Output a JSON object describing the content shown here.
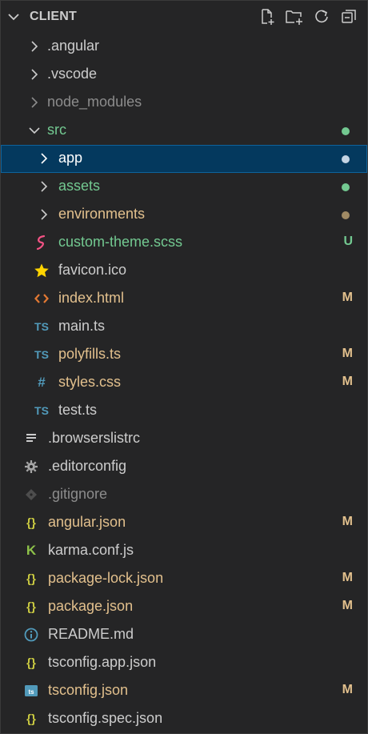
{
  "header": {
    "title": "CLIENT",
    "actions": [
      {
        "name": "new-file-icon"
      },
      {
        "name": "new-folder-icon"
      },
      {
        "name": "refresh-icon"
      },
      {
        "name": "collapse-all-icon"
      }
    ]
  },
  "tree": {
    "angular_folder": ".angular",
    "vscode_folder": ".vscode",
    "node_modules_folder": "node_modules",
    "src_folder": "src",
    "app_folder": "app",
    "assets_folder": "assets",
    "environments_folder": "environments",
    "custom_theme_file": "custom-theme.scss",
    "custom_theme_badge": "U",
    "favicon_file": "favicon.ico",
    "index_html_file": "index.html",
    "index_html_badge": "M",
    "main_ts_file": "main.ts",
    "polyfills_file": "polyfills.ts",
    "polyfills_badge": "M",
    "styles_file": "styles.css",
    "styles_badge": "M",
    "test_ts_file": "test.ts",
    "browserslistrc_file": ".browserslistrc",
    "editorconfig_file": ".editorconfig",
    "gitignore_file": ".gitignore",
    "angular_json_file": "angular.json",
    "angular_json_badge": "M",
    "karma_file": "karma.conf.js",
    "package_lock_file": "package-lock.json",
    "package_lock_badge": "M",
    "package_json_file": "package.json",
    "package_json_badge": "M",
    "readme_file": "README.md",
    "tsconfig_app_file": "tsconfig.app.json",
    "tsconfig_file": "tsconfig.json",
    "tsconfig_badge": "M",
    "tsconfig_spec_file": "tsconfig.spec.json",
    "ts_icon_text": "TS",
    "json_icon_text": "{}",
    "hash_icon_text": "#",
    "karma_icon_text": "K"
  },
  "colors": {
    "background": "#252526",
    "selected": "#04395e",
    "untracked_green": "#73c991",
    "modified_yellow": "#e2c08d",
    "ignored_gray": "#8c8c8c",
    "default_text": "#cccccc",
    "ts_blue": "#519aba",
    "json_yellow": "#cbcb41",
    "html_orange": "#e37933",
    "scss_pink": "#f55385",
    "readme_blue": "#519aba"
  }
}
